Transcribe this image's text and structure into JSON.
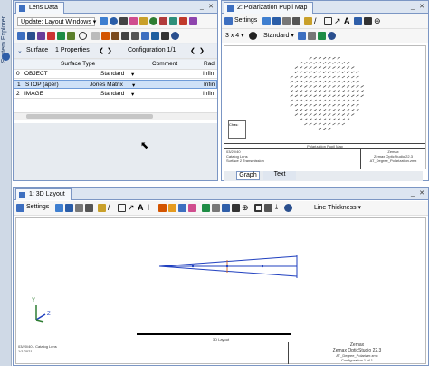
{
  "sidebar": {
    "label": "System Explorer"
  },
  "lens": {
    "tab": "Lens Data",
    "update_label": "Update: Layout Windows",
    "surface_label": "Surface",
    "properties_label": "1 Properties",
    "config_label": "Configuration 1/1",
    "columns": [
      "Surface Type",
      "Comment",
      "Rad"
    ],
    "rows": [
      {
        "num": "0",
        "name": "OBJECT",
        "type": "Standard",
        "rad": "Infin"
      },
      {
        "num": "1",
        "name": "STOP (aper)",
        "type": "Jones Matrix",
        "rad": "Infin"
      },
      {
        "num": "2",
        "name": "IMAGE",
        "type": "Standard",
        "rad": "Infin"
      }
    ]
  },
  "pol": {
    "tab": "2: Polarization Pupil Map",
    "settings": "Settings",
    "grid_size": "3 x 4",
    "mode": "Standard",
    "chart_title": "Polarization Pupil Map",
    "chart_box_label": "Chas:",
    "footer_left": [
      "03/20/40",
      "Catalog Lens",
      "1/1/2021",
      "Field Pos",
      "Wavelength",
      "Config",
      "Sample",
      "Surface 2 Transmission"
    ],
    "footer_right": [
      "Zemax",
      "Zemax OpticStudio 22.3",
      "",
      "AT_Degree_Polarization.zmx"
    ],
    "bottom_tabs": [
      "Graph",
      "Text"
    ]
  },
  "layout3d": {
    "tab": "1: 3D Layout",
    "settings": "Settings",
    "line_thickness": "Line Thickness",
    "axis_y": "Y",
    "axis_z": "Z",
    "scale_label": "3D Layout",
    "footer_left": [
      "03/20/40 - Catalog Lens",
      "1/1/2021"
    ],
    "footer_right": [
      "Zemax",
      "Zemax OpticStudio 22.3",
      "",
      "AT_Degree_Polarizer.zmx",
      "Configuration 1 of 1"
    ]
  },
  "colors": {
    "accent": "#3d6fc0",
    "ray": "#1f3fbf",
    "lens_mark": "#d0703a",
    "sel_row": "#cfe1f7"
  }
}
